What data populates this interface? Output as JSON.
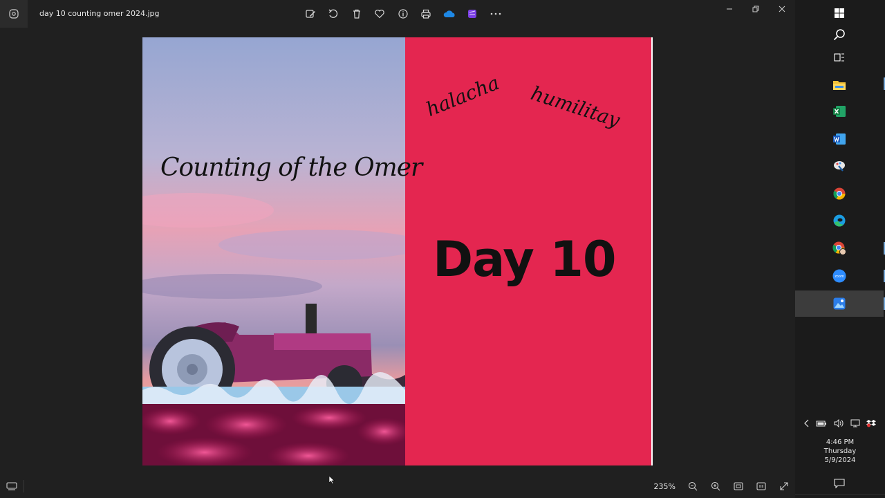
{
  "window": {
    "file_name": "day 10 counting omer 2024.jpg"
  },
  "toolbar": {
    "buttons": [
      {
        "name": "edit-image-button",
        "icon": "edit-image-icon"
      },
      {
        "name": "rotate-button",
        "icon": "rotate-icon"
      },
      {
        "name": "delete-button",
        "icon": "trash-icon"
      },
      {
        "name": "favorite-button",
        "icon": "heart-icon"
      },
      {
        "name": "info-button",
        "icon": "info-icon"
      },
      {
        "name": "print-button",
        "icon": "printer-icon"
      },
      {
        "name": "onedrive-button",
        "icon": "cloud-icon"
      },
      {
        "name": "clipchamp-button",
        "icon": "clipchamp-icon"
      },
      {
        "name": "more-options-button",
        "icon": "ellipsis-icon"
      }
    ]
  },
  "image": {
    "title": "Counting of the Omer",
    "word_left": "halacha",
    "word_right": "humilitay",
    "day_label": "Day 10",
    "colors": {
      "panel_pink": "#e42650",
      "sky_top": "#9aa7cf",
      "sky_pink": "#e99bb1",
      "tulip_magenta": "#c2185b"
    }
  },
  "statusbar": {
    "zoom": "235%"
  },
  "taskbar": {
    "items": [
      {
        "name": "start-button",
        "icon": "windows-logo-icon"
      },
      {
        "name": "search-button",
        "icon": "search-icon"
      },
      {
        "name": "task-view-button",
        "icon": "task-view-icon"
      },
      {
        "name": "file-explorer-button",
        "icon": "folder-icon"
      },
      {
        "name": "excel-button",
        "icon": "excel-icon"
      },
      {
        "name": "word-button",
        "icon": "word-icon"
      },
      {
        "name": "paint-button",
        "icon": "paint-icon"
      },
      {
        "name": "chrome-button",
        "icon": "chrome-icon"
      },
      {
        "name": "edge-button",
        "icon": "edge-icon"
      },
      {
        "name": "chrome-profile-button",
        "icon": "chrome-profile-icon"
      },
      {
        "name": "zoom-app-button",
        "icon": "zoom-icon"
      },
      {
        "name": "photos-app-button",
        "icon": "photos-icon"
      }
    ],
    "zoom_app_text": "zoom",
    "clock": {
      "time": "4:46 PM",
      "day": "Thursday",
      "date": "5/9/2024"
    }
  }
}
